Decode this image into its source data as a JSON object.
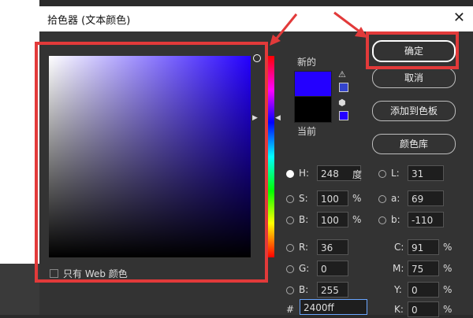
{
  "dialog": {
    "title": "拾色器 (文本颜色)",
    "close_glyph": "✕"
  },
  "preview": {
    "new_label": "新的",
    "current_label": "当前",
    "new_color": "#2400ff",
    "current_color": "#000000"
  },
  "buttons": {
    "ok": "确定",
    "cancel": "取消",
    "add_swatches": "添加到色板",
    "color_libraries": "颜色库"
  },
  "fields": {
    "H": {
      "label": "H:",
      "value": "248",
      "unit": "度"
    },
    "S": {
      "label": "S:",
      "value": "100",
      "unit": "%"
    },
    "B": {
      "label": "B:",
      "value": "100",
      "unit": "%"
    },
    "R": {
      "label": "R:",
      "value": "36"
    },
    "G": {
      "label": "G:",
      "value": "0"
    },
    "Bl": {
      "label": "B:",
      "value": "255"
    },
    "L": {
      "label": "L:",
      "value": "31"
    },
    "a": {
      "label": "a:",
      "value": "69"
    },
    "b": {
      "label": "b:",
      "value": "-110"
    },
    "C": {
      "label": "C:",
      "value": "91",
      "unit": "%"
    },
    "M": {
      "label": "M:",
      "value": "75",
      "unit": "%"
    },
    "Y": {
      "label": "Y:",
      "value": "0",
      "unit": "%"
    },
    "K": {
      "label": "K:",
      "value": "0",
      "unit": "%"
    },
    "hex": {
      "label": "#",
      "value": "2400ff"
    }
  },
  "only_web_colors_label": "只有 Web 颜色",
  "icons": {
    "warning": "⚠",
    "cube": "⬢",
    "triangle_right": "▶",
    "triangle_left": "◀"
  },
  "colors": {
    "annotation_red": "#e23a3a",
    "hue_color": "#2400ff"
  }
}
